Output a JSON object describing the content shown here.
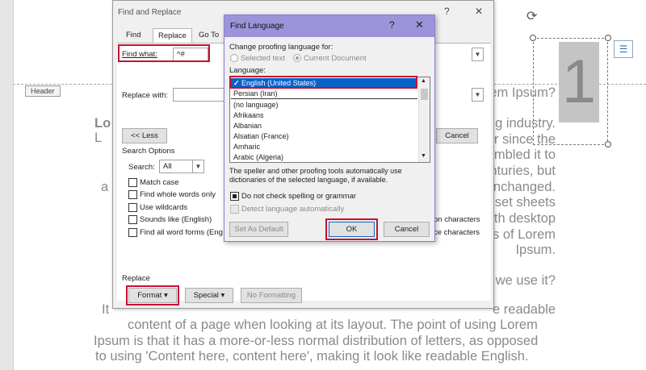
{
  "document": {
    "header_tag": "Header",
    "big_number": "1",
    "right_lines": [
      "orem Ipsum?",
      "g industry.",
      "r since the",
      "mbled it to",
      "nturies, but",
      "unchanged.",
      "set sheets",
      "th desktop",
      "s of Lorem",
      "Ipsum.",
      "we use it?",
      "e readable"
    ],
    "left_fragments": {
      "lo": "Lo",
      "l": "L",
      "a": "a",
      "it": "It"
    },
    "body_lines": [
      "content of a page when looking at its layout. The point of using Lorem",
      "Ipsum is that it has a more-or-less normal distribution of letters, as opposed",
      "to using 'Content here, content here', making it look like readable English."
    ]
  },
  "find_replace": {
    "title": "Find and Replace",
    "help": "?",
    "close": "✕",
    "tabs": [
      "Find",
      "Replace",
      "Go To"
    ],
    "find_what_label": "Find what:",
    "find_what_value": "^#",
    "replace_with_label": "Replace with:",
    "less_button": "<< Less",
    "cancel_button": "Cancel",
    "search_options_label": "Search Options",
    "search_label": "Search:",
    "search_value": "All",
    "checkboxes": [
      "Match case",
      "Find whole words only",
      "Use wildcards",
      "Sounds like (English)",
      "Find all word forms (Eng"
    ],
    "right_options": [
      "on characters",
      "ce characters"
    ],
    "replace_section_label": "Replace",
    "format_button": "Format",
    "special_button": "Special",
    "no_formatting_button": "No Formatting"
  },
  "find_language": {
    "title": "Find Language",
    "help": "?",
    "close": "✕",
    "change_label": "Change proofing language for:",
    "radio_selected_text": "Selected text",
    "radio_current_document": "Current Document",
    "language_label": "Language:",
    "languages": [
      "English (United States)",
      "Persian (Iran)",
      "(no language)",
      "Afrikaans",
      "Albanian",
      "Alsatian (France)",
      "Amharic",
      "Arabic (Algeria)"
    ],
    "selected_index": 0,
    "info_text_1": "The speller and other proofing tools automatically use",
    "info_text_2": "dictionaries of the selected language, if available.",
    "do_not_check_label": "Do not check spelling or grammar",
    "detect_label": "Detect language automatically",
    "set_default_button": "Set As Default",
    "ok_button": "OK",
    "cancel_button": "Cancel"
  },
  "colors": {
    "highlight": "#c8102e",
    "selection": "#0a62c9",
    "title_bar": "#9b94d8"
  }
}
